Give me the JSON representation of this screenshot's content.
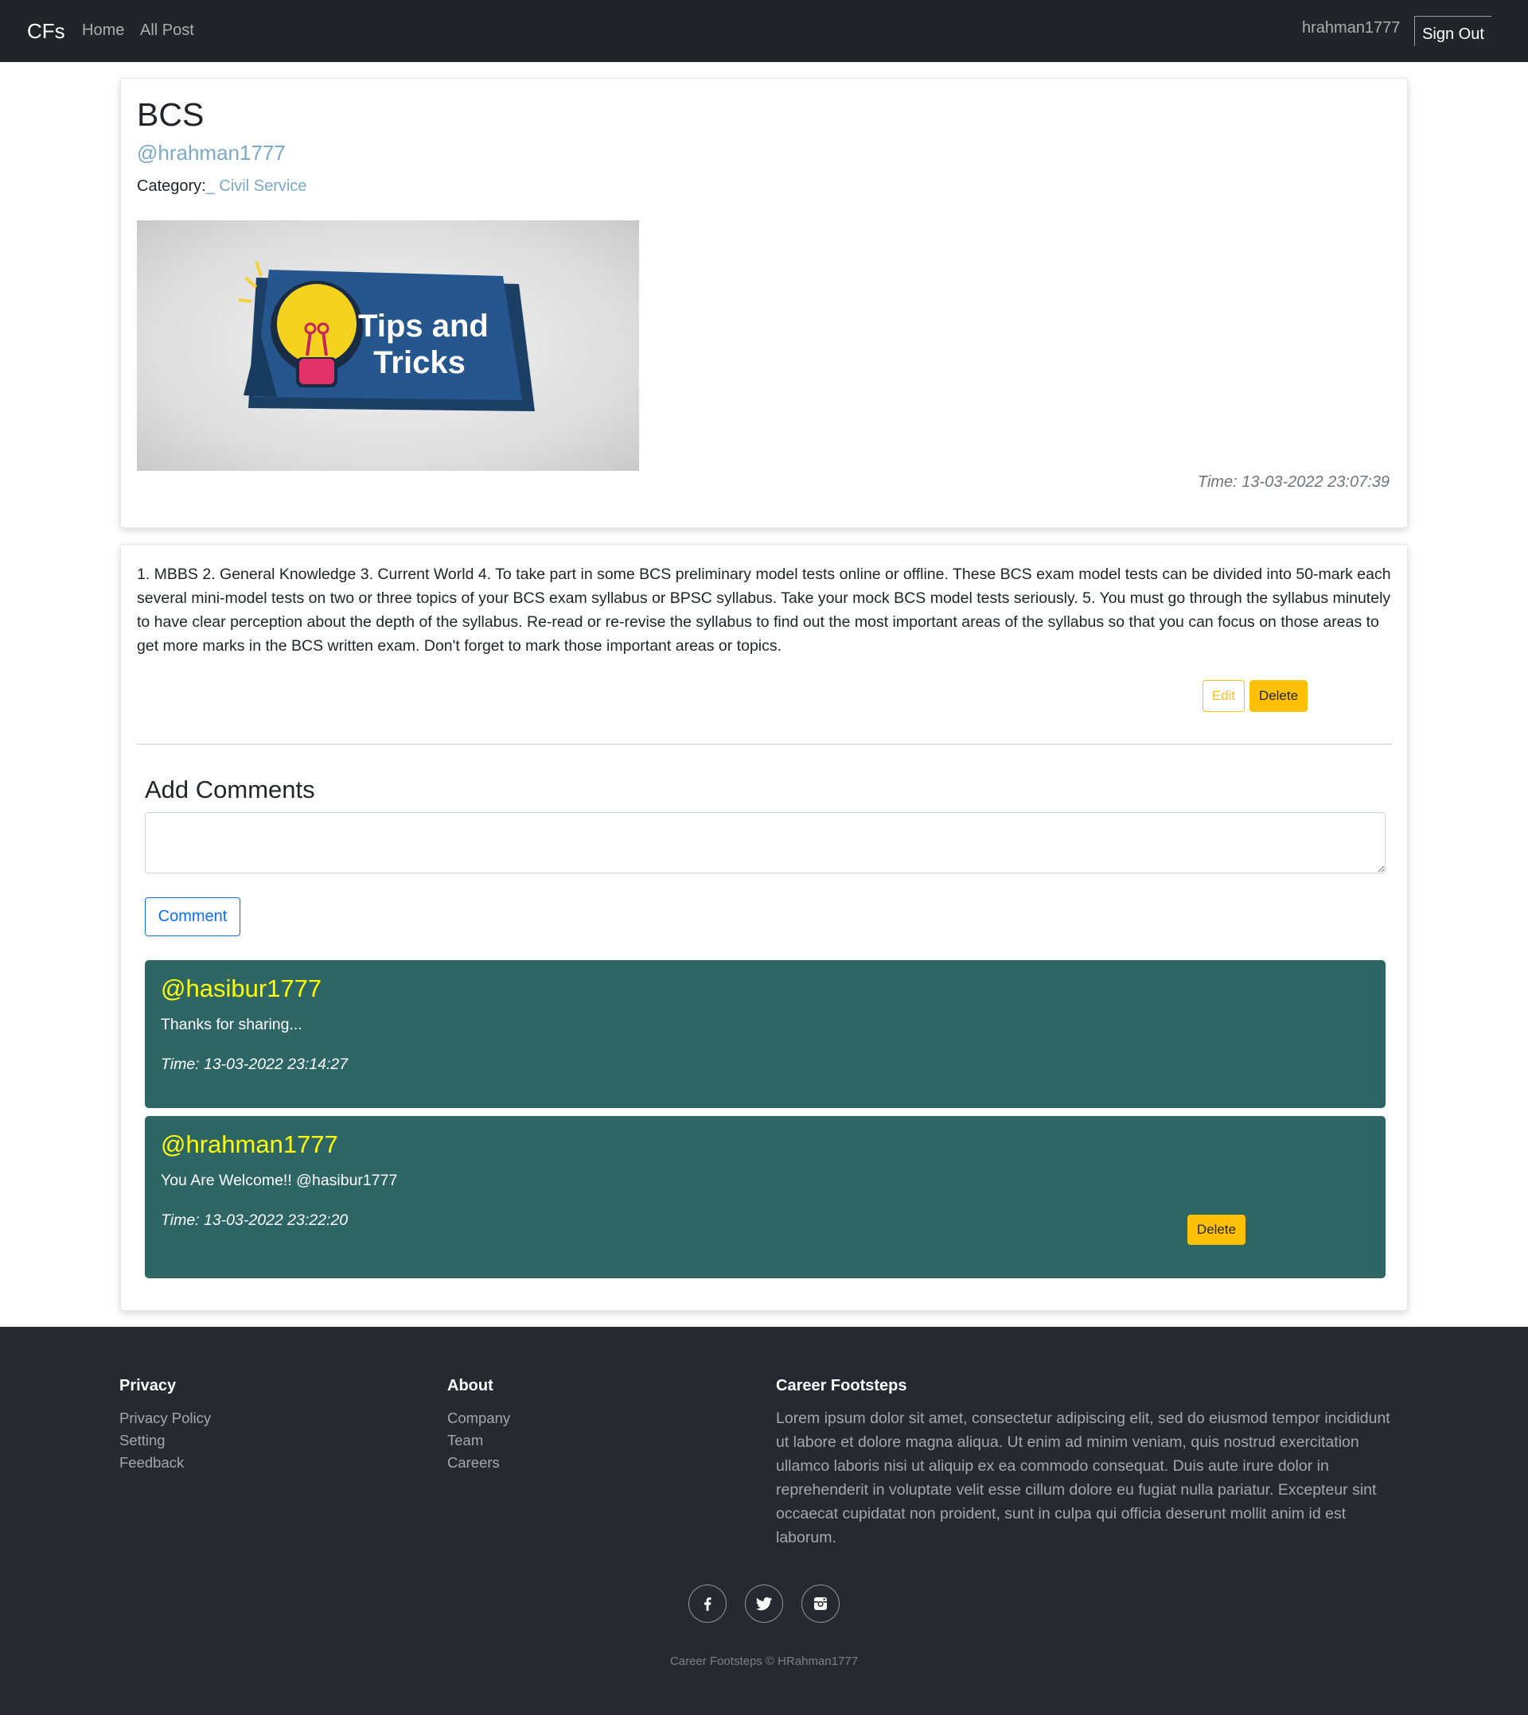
{
  "navbar": {
    "brand": "CFs",
    "links": [
      "Home",
      "All Post"
    ],
    "username": "hrahman1777",
    "sign_out": "Sign Out"
  },
  "post": {
    "title": "BCS",
    "author": "@hrahman1777",
    "category_label": "Category:",
    "category_value": "_ Civil Service",
    "image_text_line1": "Tips and",
    "image_text_line2": "Tricks",
    "time": "Time: 13-03-2022 23:07:39",
    "body": "1. MBBS 2. General Knowledge 3. Current World 4. To take part in some BCS preliminary model tests online or offline. These BCS exam model tests can be divided into 50-mark each several mini-model tests on two or three topics of your BCS exam syllabus or BPSC syllabus. Take your mock BCS model tests seriously. 5. You must go through the syllabus minutely to have clear perception about the depth of the syllabus. Re-read or re-revise the syllabus to find out the most important areas of the syllabus so that you can focus on those areas to get more marks in the BCS written exam. Don't forget to mark those important areas or topics.",
    "edit_label": "Edit",
    "delete_label": "Delete"
  },
  "comments_section": {
    "heading": "Add Comments",
    "input_value": "",
    "button_label": "Comment",
    "items": [
      {
        "author": "@hasibur1777",
        "text": "Thanks for sharing...",
        "time": "Time: 13-03-2022 23:14:27"
      },
      {
        "author": "@hrahman1777",
        "text": "You Are Welcome!! @hasibur1777",
        "time": "Time: 13-03-2022 23:22:20",
        "delete_label": "Delete"
      }
    ]
  },
  "footer": {
    "privacy": {
      "heading": "Privacy",
      "links": [
        "Privacy Policy",
        "Setting",
        "Feedback"
      ]
    },
    "about": {
      "heading": "About",
      "links": [
        "Company",
        "Team",
        "Careers"
      ]
    },
    "career": {
      "heading": "Career Footsteps",
      "text": "Lorem ipsum dolor sit amet, consectetur adipiscing elit, sed do eiusmod tempor incididunt ut labore et dolore magna aliqua. Ut enim ad minim veniam, quis nostrud exercitation ullamco laboris nisi ut aliquip ex ea commodo consequat. Duis aute irure dolor in reprehenderit in voluptate velit esse cillum dolore eu fugiat nulla pariatur. Excepteur sint occaecat cupidatat non proident, sunt in culpa qui officia deserunt mollit anim id est laborum."
    },
    "social_icons": [
      "facebook-icon",
      "twitter-icon",
      "instagram-icon"
    ],
    "copyright": "Career Footsteps © HRahman1777"
  },
  "colors": {
    "navbar_bg": "#212529",
    "footer_bg": "#262a30",
    "comment_bg": "#2e6666",
    "comment_author": "#ffff00",
    "link_blue": "#7aa9c9",
    "warning": "#ffc107",
    "primary": "#0d6efd"
  }
}
